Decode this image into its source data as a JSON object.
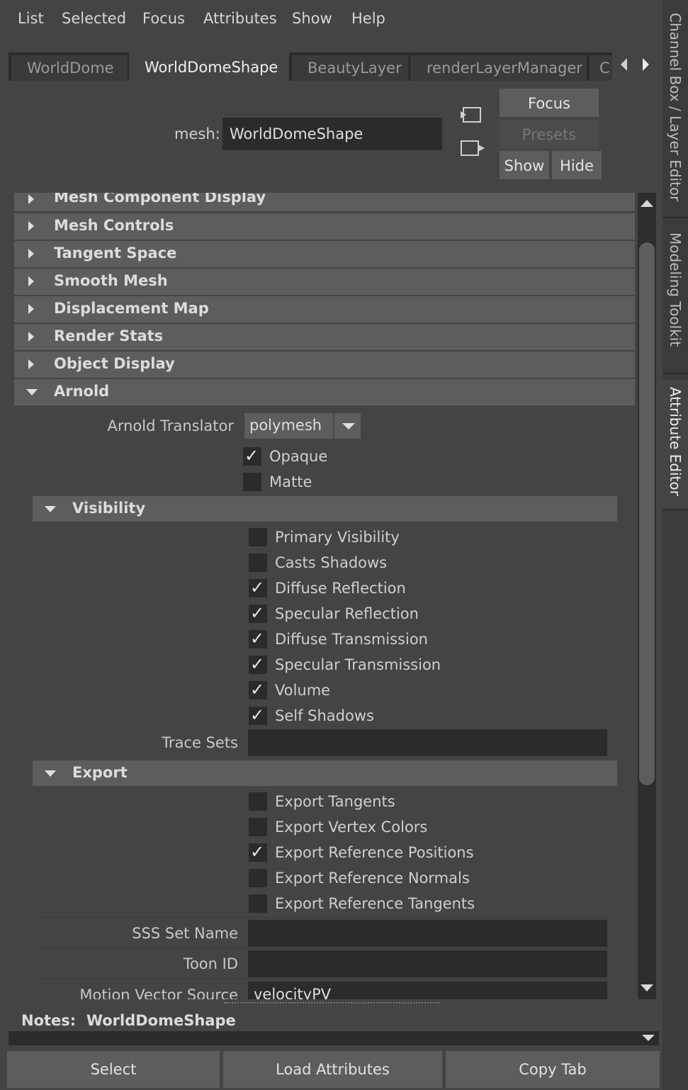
{
  "menu": [
    "List",
    "Selected",
    "Focus",
    "Attributes",
    "Show",
    "Help"
  ],
  "tabs": [
    "WorldDome",
    "WorldDomeShape",
    "BeautyLayer",
    "renderLayerManager",
    "C"
  ],
  "node": {
    "label": "mesh:",
    "value": "WorldDomeShape"
  },
  "buttons": {
    "focus": "Focus",
    "presets": "Presets",
    "show": "Show",
    "hide": "Hide"
  },
  "sections": [
    "Mesh Component Display",
    "Mesh Controls",
    "Tangent Space",
    "Smooth Mesh",
    "Displacement Map",
    "Render Stats",
    "Object Display",
    "Arnold"
  ],
  "arnold": {
    "translator_label": "Arnold Translator",
    "translator_value": "polymesh",
    "opaque": {
      "label": "Opaque",
      "checked": true
    },
    "matte": {
      "label": "Matte",
      "checked": false
    }
  },
  "visibility": {
    "title": "Visibility",
    "items": [
      {
        "label": "Primary Visibility",
        "checked": false
      },
      {
        "label": "Casts Shadows",
        "checked": false
      },
      {
        "label": "Diffuse Reflection",
        "checked": true
      },
      {
        "label": "Specular Reflection",
        "checked": true
      },
      {
        "label": "Diffuse Transmission",
        "checked": true
      },
      {
        "label": "Specular Transmission",
        "checked": true
      },
      {
        "label": "Volume",
        "checked": true
      },
      {
        "label": "Self Shadows",
        "checked": true
      }
    ],
    "trace_sets_label": "Trace Sets",
    "trace_sets_value": ""
  },
  "export": {
    "title": "Export",
    "items": [
      {
        "label": "Export Tangents",
        "checked": false
      },
      {
        "label": "Export Vertex Colors",
        "checked": false
      },
      {
        "label": "Export Reference Positions",
        "checked": true
      },
      {
        "label": "Export Reference Normals",
        "checked": false
      },
      {
        "label": "Export Reference Tangents",
        "checked": false
      }
    ],
    "sss_label": "SSS Set Name",
    "toon_label": "Toon ID",
    "motion_label": "Motion Vector Source",
    "motion_value": "velocityPV"
  },
  "notes": {
    "label": "Notes:",
    "value": "WorldDomeShape"
  },
  "bottom_buttons": [
    "Select",
    "Load Attributes",
    "Copy Tab"
  ],
  "right_tabs": [
    "Channel Box / Layer Editor",
    "Modeling Toolkit",
    "Attribute Editor"
  ],
  "check_glyph": "✓"
}
